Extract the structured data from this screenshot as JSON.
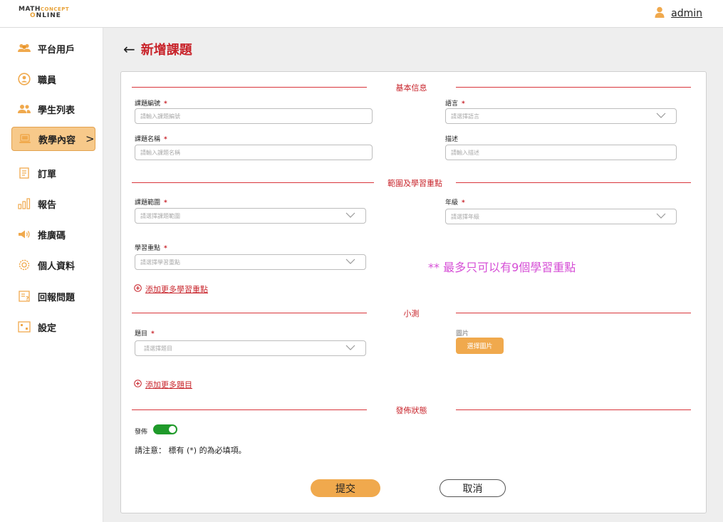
{
  "header": {
    "logo_line1_main": "MATH",
    "logo_line1_accent": "CONCEPT",
    "logo_line2_o": "O",
    "logo_line2_rest": "NLINE",
    "username": "admin"
  },
  "sidebar": {
    "items": [
      {
        "label": "平台用戶",
        "icon": "users-group-icon"
      },
      {
        "label": "職員",
        "icon": "person-circle-icon"
      },
      {
        "label": "學生列表",
        "icon": "students-icon"
      },
      {
        "label": "教學內容",
        "icon": "laptop-icon",
        "active": true
      },
      {
        "label": "訂單",
        "icon": "document-list-icon"
      },
      {
        "label": "報告",
        "icon": "bar-chart-icon"
      },
      {
        "label": "推廣碼",
        "icon": "megaphone-icon"
      },
      {
        "label": "個人資料",
        "icon": "gear-icon"
      },
      {
        "label": "回報問題",
        "icon": "feedback-icon"
      },
      {
        "label": "設定",
        "icon": "settings-frame-icon"
      }
    ],
    "active_chevron": ">"
  },
  "page": {
    "back": "←",
    "title": "新增課題"
  },
  "sections": {
    "basic": "基本信息",
    "scope": "範圍及學習重點",
    "quiz": "小測",
    "publish": "發佈狀態"
  },
  "form": {
    "topic_code": {
      "label": "課題編號",
      "placeholder": "請輸入課題編號"
    },
    "language": {
      "label": "語言",
      "placeholder": "請選擇語言"
    },
    "topic_name": {
      "label": "課題名稱",
      "placeholder": "請輸入課題名稱"
    },
    "description": {
      "label": "描述",
      "placeholder": "請輸入描述"
    },
    "topic_scope": {
      "label": "課題範圍",
      "placeholder": "請選擇課題範圍"
    },
    "grade": {
      "label": "年級",
      "placeholder": "請選擇年級"
    },
    "learning_focus": {
      "label": "學習重點",
      "placeholder": "請選擇學習重點"
    },
    "focus_limit_note": "** 最多只可以有9個學習重點",
    "add_focus": "添加更多學習重點",
    "question": {
      "label": "題目",
      "placeholder": "請選擇題目"
    },
    "image_label": "圖片",
    "choose_image": "選擇圖片",
    "add_question": "添加更多題目",
    "publish_label": "發佈",
    "publish_on": true,
    "notice": "請注意： 標有 (*) 的為必填項。",
    "required_mark": "*"
  },
  "actions": {
    "submit": "提交",
    "cancel": "取消"
  },
  "colors": {
    "accent_red": "#c8242b",
    "accent_orange": "#f0a94d",
    "toggle_green": "#1f9a2a",
    "note_pink": "#d64fd6"
  }
}
